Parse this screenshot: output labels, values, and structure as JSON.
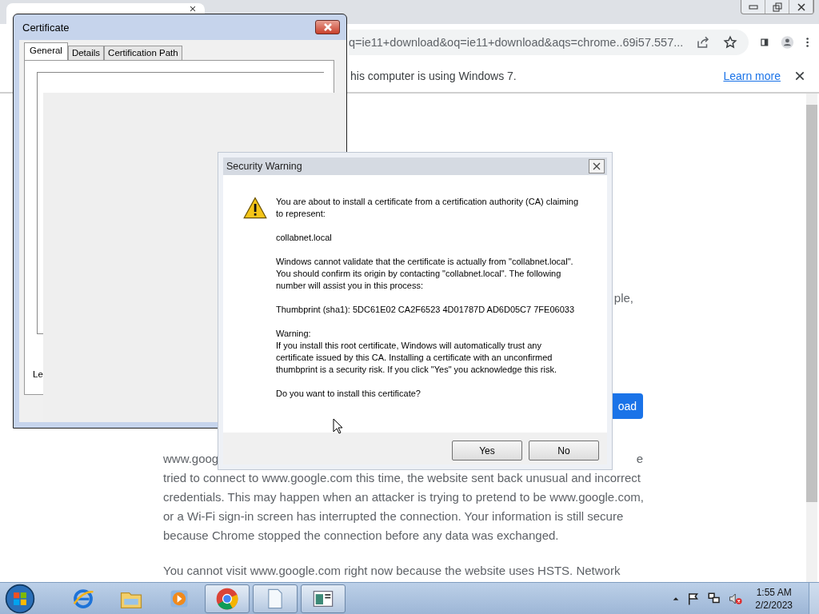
{
  "browser": {
    "address": "q=ie11+download&oq=ie11+download&aqs=chrome..69i57.557...",
    "infobar": {
      "message": "his computer is using Windows 7.",
      "link": "Learn more"
    },
    "page": {
      "side_text": "ple,",
      "button": "oad",
      "first_line": [
        "www.goog",
        "e"
      ],
      "lines": [
        "tried to connect to www.google.com this time, the website sent back unusual and incorrect",
        "credentials. This may happen when an attacker is trying to pretend to be www.google.com,",
        "or a Wi-Fi sign-in screen has interrupted the connection. Your information is still secure",
        "because Chrome stopped the connection before any data was exchanged."
      ],
      "last_line": "You cannot visit www.google.com right now because the website uses HSTS. Network"
    }
  },
  "certificate_window": {
    "title": "Certificate",
    "tabs": [
      {
        "label": "General",
        "selected": true
      },
      {
        "label": "Details",
        "selected": false
      },
      {
        "label": "Certification Path",
        "selected": false
      }
    ],
    "visible_text": "Le"
  },
  "security_warning": {
    "title": "Security Warning",
    "paragraphs": [
      {
        "text": "You are about to install a certificate from a certification authority (CA) claiming to represent:"
      },
      {
        "text": "collabnet.local"
      },
      {
        "text": "Windows cannot validate that the certificate is actually from \"collabnet.local\". You should confirm its origin by contacting \"collabnet.local\". The following number will assist you in this process:"
      },
      {
        "text": "Thumbprint (sha1): 5DC61E02 CA2F6523 4D01787D AD6D05C7 7FE06033"
      },
      {
        "heading": "Warning:",
        "text": "If you install this root certificate, Windows will automatically trust any certificate issued by this CA. Installing a certificate with an unconfirmed thumbprint is a security risk. If you click \"Yes\" you acknowledge this risk."
      },
      {
        "text": "Do you want to install this certificate?"
      }
    ],
    "buttons": [
      "Yes",
      "No"
    ]
  },
  "taskbar": {
    "apps": [
      {
        "kind": "ie",
        "running": false
      },
      {
        "kind": "folder",
        "running": false
      },
      {
        "kind": "media",
        "running": false
      },
      {
        "kind": "chrome",
        "running": true
      },
      {
        "kind": "document",
        "running": true
      },
      {
        "kind": "window",
        "running": true
      }
    ],
    "clock": {
      "time": "1:55 AM",
      "date": "2/2/2023"
    }
  }
}
